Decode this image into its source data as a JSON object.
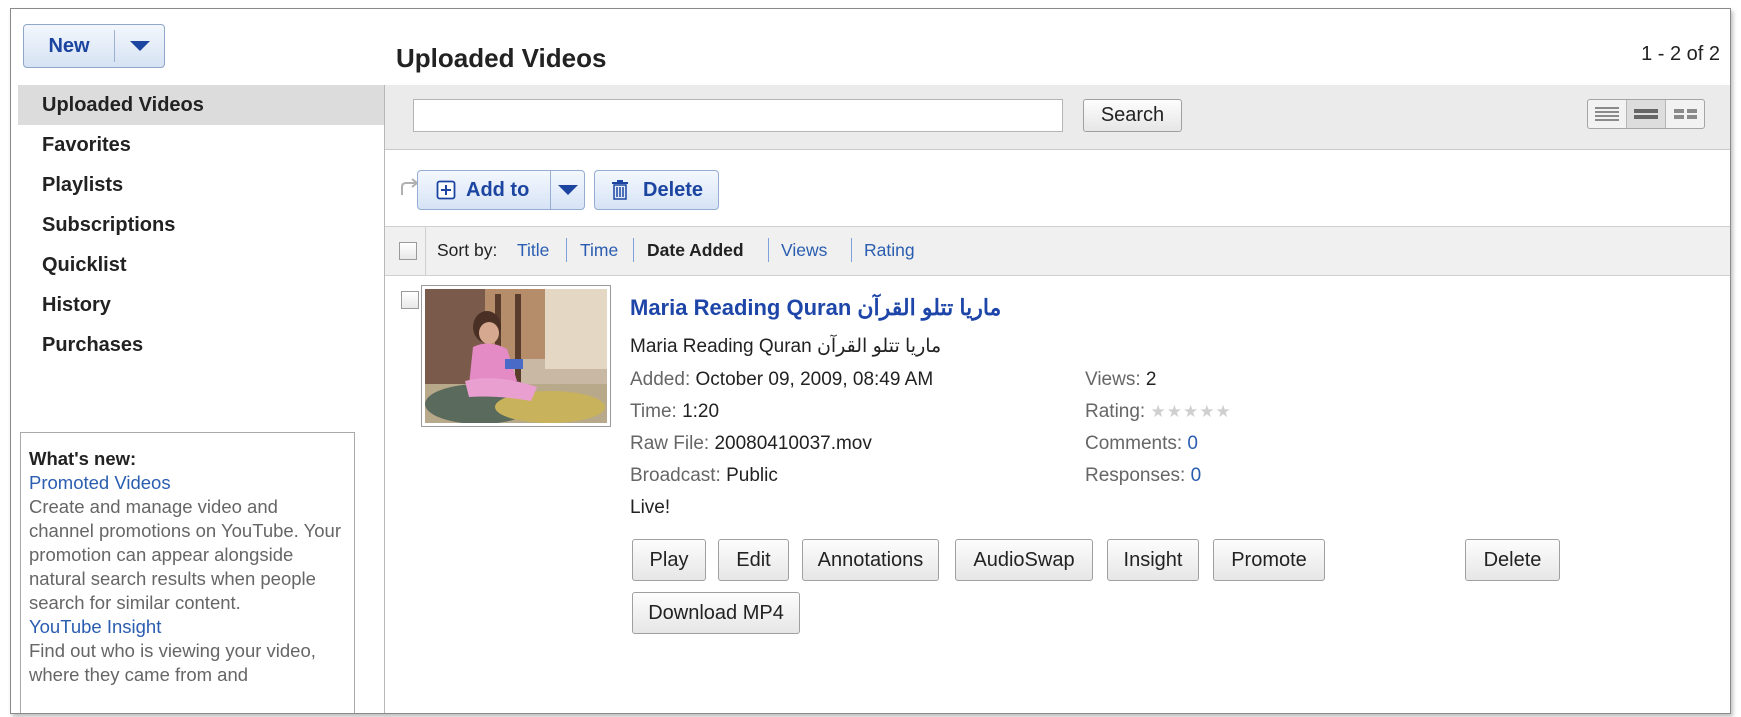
{
  "new_menu": {
    "label": "New"
  },
  "header": {
    "title": "Uploaded Videos",
    "pagination": "1 - 2 of 2"
  },
  "sidebar": {
    "items": [
      {
        "label": "Uploaded Videos",
        "active": true
      },
      {
        "label": "Favorites"
      },
      {
        "label": "Playlists"
      },
      {
        "label": "Subscriptions"
      },
      {
        "label": "Quicklist"
      },
      {
        "label": "History"
      },
      {
        "label": "Purchases"
      }
    ],
    "whats_new": {
      "heading": "What's new:",
      "item1_title": "Promoted Videos",
      "item1_text": "Create and manage video and channel promotions on YouTube. Your promotion can appear alongside natural search results when people search for similar content.",
      "item2_title": "YouTube Insight",
      "item2_text": "Find out who is viewing your video, where they came from and"
    }
  },
  "search": {
    "value": "",
    "button_label": "Search"
  },
  "toolbar": {
    "add_to_label": "Add to",
    "delete_label": "Delete"
  },
  "sort": {
    "prefix": "Sort by:",
    "options": [
      "Title",
      "Time",
      "Date Added",
      "Views",
      "Rating"
    ],
    "active": "Date Added"
  },
  "video": {
    "title": "Maria Reading Quran ماريا تتلو القرآن",
    "description": "Maria Reading Quran ماريا تتلو القرآن",
    "added_label": "Added:",
    "added_value": "October 09, 2009, 08:49 AM",
    "time_label": "Time:",
    "time_value": "1:20",
    "raw_label": "Raw File:",
    "raw_value": "20080410037.mov",
    "broadcast_label": "Broadcast:",
    "broadcast_value": "Public",
    "status": "Live!",
    "views_label": "Views:",
    "views_value": "2",
    "rating_label": "Rating:",
    "rating_stars": "★★★★★",
    "rating_value": 0,
    "comments_label": "Comments:",
    "comments_value": "0",
    "responses_label": "Responses:",
    "responses_value": "0",
    "actions": {
      "play": "Play",
      "edit": "Edit",
      "annotations": "Annotations",
      "audioswap": "AudioSwap",
      "insight": "Insight",
      "promote": "Promote",
      "delete": "Delete",
      "download": "Download MP4"
    }
  },
  "colors": {
    "link": "#2a5db0",
    "title_blue": "#1e46a8",
    "accent_button": "#d6e3f5"
  }
}
